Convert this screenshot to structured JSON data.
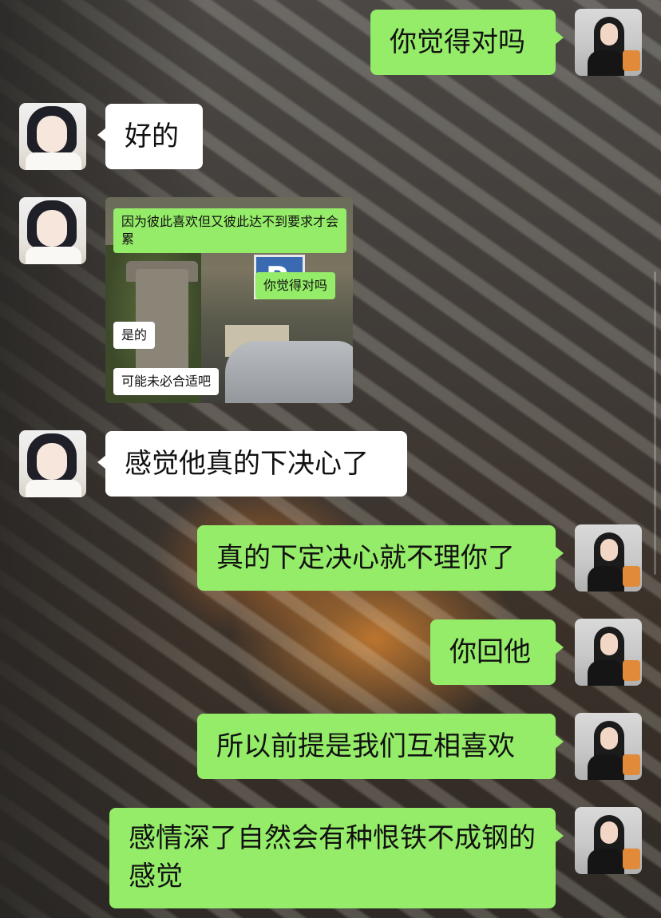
{
  "background": {
    "theme": "sunlit-stripes-wallpaper"
  },
  "messages": [
    {
      "side": "right",
      "text": "你觉得对吗"
    },
    {
      "side": "left",
      "text": "好的"
    },
    {
      "side": "left",
      "type": "image"
    },
    {
      "side": "left",
      "text": "感觉他真的下决心了"
    },
    {
      "side": "right",
      "text": "真的下定决心就不理你了"
    },
    {
      "side": "right",
      "text": "你回他"
    },
    {
      "side": "right",
      "text": "所以前提是我们互相喜欢"
    },
    {
      "side": "right",
      "text": "感情深了自然会有种恨铁不成钢的感觉"
    }
  ],
  "embedded_image": {
    "messages": [
      {
        "side": "right",
        "text": "因为彼此喜欢但又彼此达不到要求才会累"
      },
      {
        "side": "right",
        "text": "你觉得对吗"
      },
      {
        "side": "left",
        "text": "是的"
      },
      {
        "side": "left",
        "text": "可能未必合适吧"
      }
    ],
    "sign_text": "P"
  },
  "colors": {
    "sent_bubble": "#95ec69",
    "received_bubble": "#ffffff"
  }
}
